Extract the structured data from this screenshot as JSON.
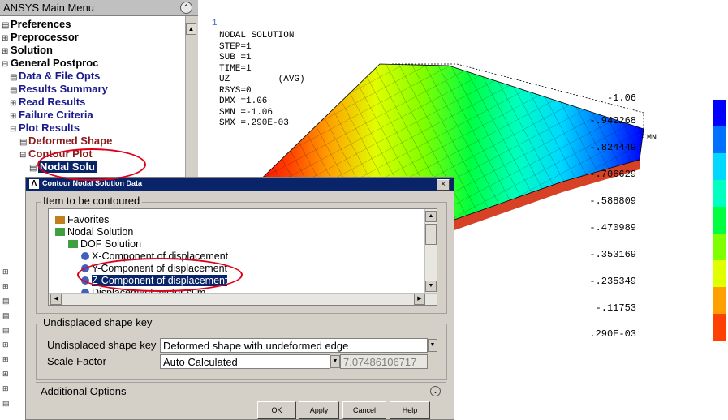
{
  "menu": {
    "title": "ANSYS Main Menu",
    "items": [
      {
        "label": "Preferences",
        "glyph": "▤"
      },
      {
        "label": "Preprocessor",
        "glyph": "⊞"
      },
      {
        "label": "Solution",
        "glyph": "⊞"
      },
      {
        "label": "General Postproc",
        "glyph": "⊟"
      },
      {
        "label": "Data & File Opts",
        "glyph": "▤"
      },
      {
        "label": "Results Summary",
        "glyph": "▤"
      },
      {
        "label": "Read Results",
        "glyph": "⊞"
      },
      {
        "label": "Failure Criteria",
        "glyph": "⊞"
      },
      {
        "label": "Plot Results",
        "glyph": "⊟"
      },
      {
        "label": "Deformed Shape",
        "glyph": "▤"
      },
      {
        "label": "Contour Plot",
        "glyph": "⊟"
      },
      {
        "label": "Nodal Solu",
        "glyph": "▤"
      }
    ]
  },
  "graphics": {
    "window_number": "1",
    "info_lines": [
      "NODAL SOLUTION",
      "",
      "STEP=1",
      "SUB =1",
      "TIME=1",
      "UZ         (AVG)",
      "RSYS=0",
      "DMX =1.06",
      "SMN =-1.06",
      "SMX =.290E-03"
    ],
    "mn_label": "MN",
    "legend": [
      {
        "value": "-1.06",
        "color": "#0000ff"
      },
      {
        "value": "-.942268",
        "color": "#0070ff"
      },
      {
        "value": "-.824449",
        "color": "#00d8ff"
      },
      {
        "value": "-.706629",
        "color": "#00ffc0"
      },
      {
        "value": "-.588809",
        "color": "#00ff40"
      },
      {
        "value": "-.470989",
        "color": "#80ff00"
      },
      {
        "value": "-.353169",
        "color": "#e0ff00"
      },
      {
        "value": "-.235349",
        "color": "#ffa000"
      },
      {
        "value": "-.11753",
        "color": "#ff4000"
      },
      {
        "value": ".290E-03",
        "color": "#ff0000"
      }
    ]
  },
  "dialog": {
    "title": "Contour Nodal Solution Data",
    "icon": "Λ",
    "close": "×",
    "group1_label": "Item to be contoured",
    "tree": [
      {
        "label": "Favorites",
        "icon_color": "#c08020"
      },
      {
        "label": "Nodal Solution",
        "icon_color": "#40a040"
      },
      {
        "label": "DOF Solution",
        "icon_color": "#40a040"
      },
      {
        "label": "X-Component of displacement",
        "icon_color": "#4060c0"
      },
      {
        "label": "Y-Component of displacement",
        "icon_color": "#4060c0"
      },
      {
        "label": "Z-Component of displacement",
        "icon_color": "#4060c0"
      },
      {
        "label": "Displacement vector sum",
        "icon_color": "#4060c0"
      }
    ],
    "group2_label": "Undisplaced shape key",
    "undisplaced_label": "Undisplaced shape key",
    "undisplaced_value": "Deformed shape with undeformed edge",
    "scale_label": "Scale Factor",
    "scale_mode": "Auto Calculated",
    "scale_value": "7.07486106717",
    "additional_options": "Additional Options",
    "buttons": {
      "ok": "OK",
      "apply": "Apply",
      "cancel": "Cancel",
      "help": "Help"
    }
  }
}
